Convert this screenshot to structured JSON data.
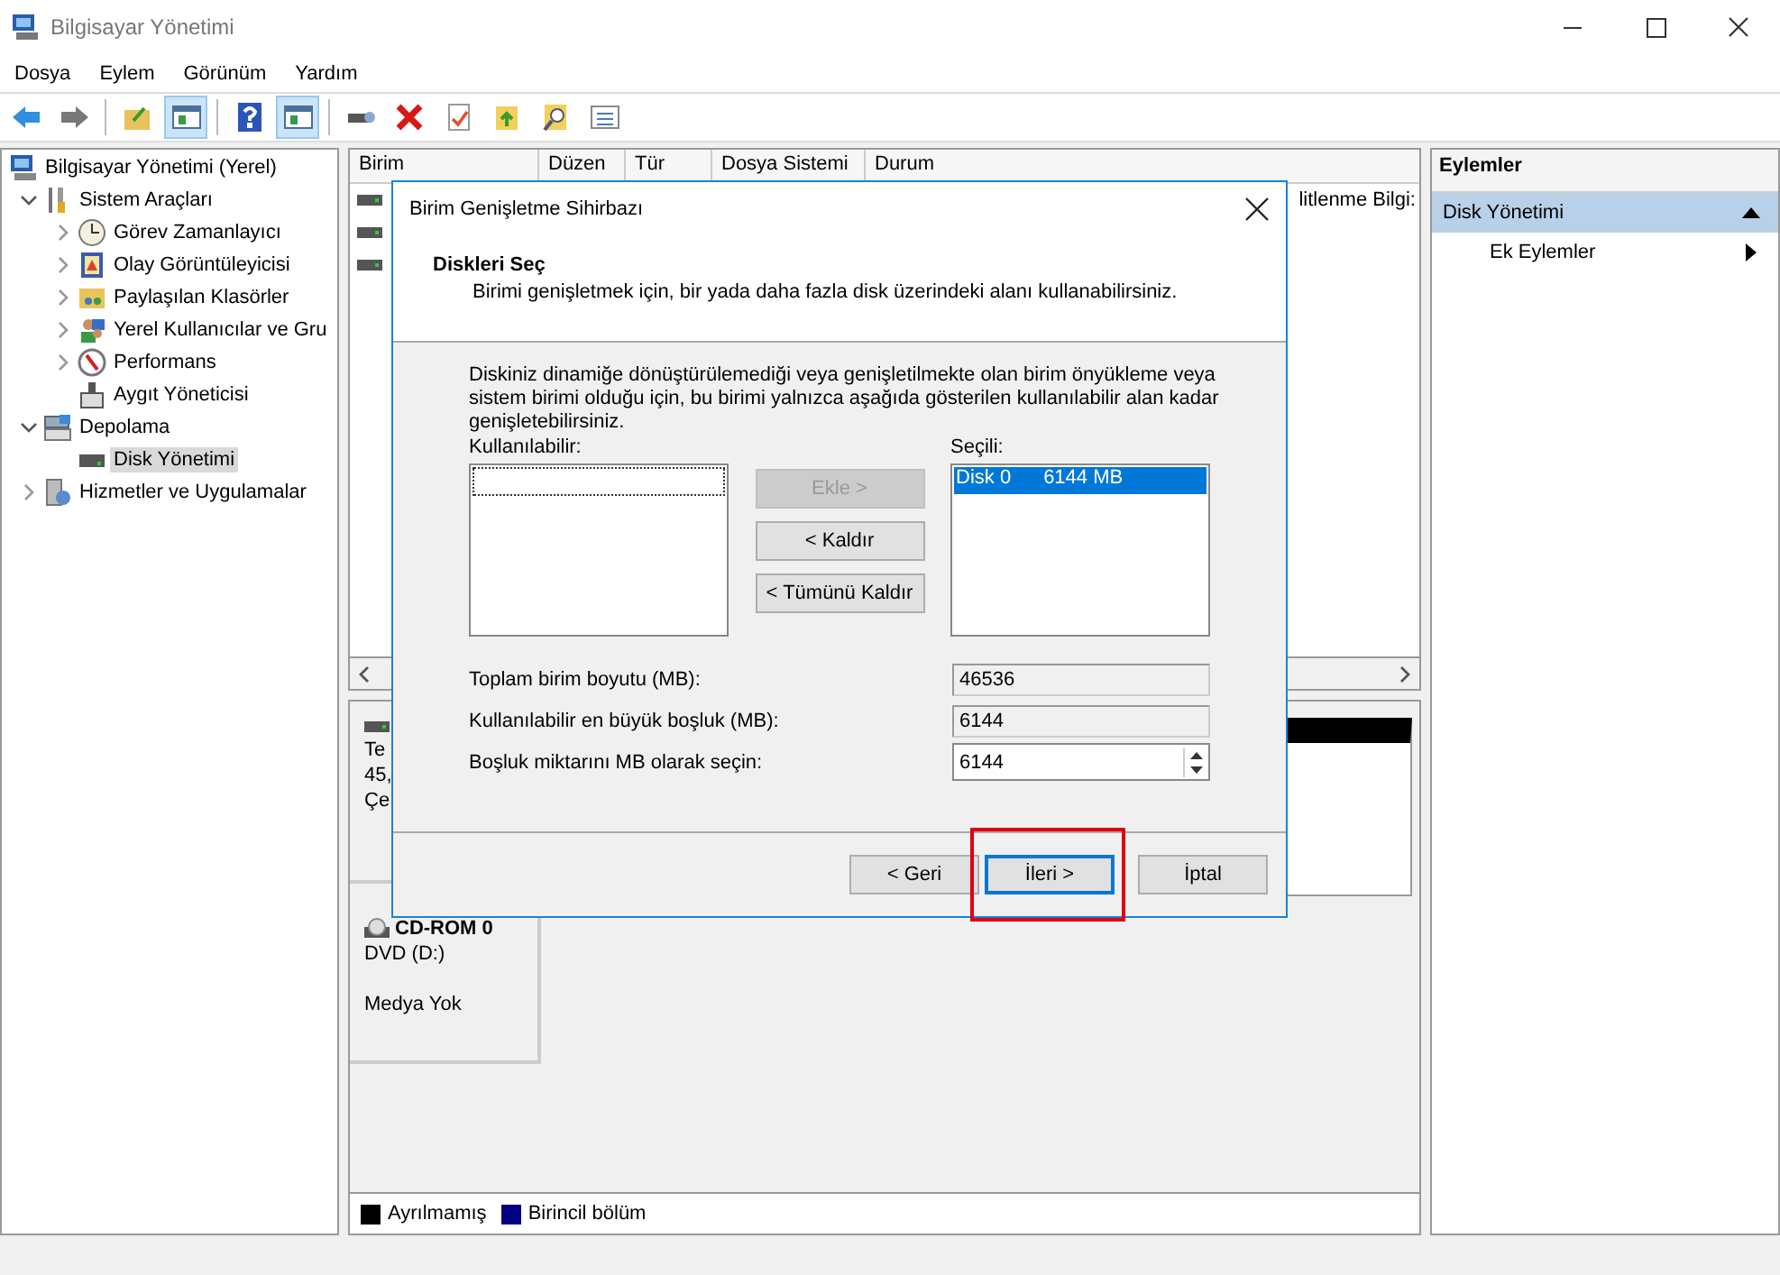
{
  "window": {
    "title": "Bilgisayar Yönetimi"
  },
  "menu": [
    "Dosya",
    "Eylem",
    "Görünüm",
    "Yardım"
  ],
  "toolbar": [
    {
      "kind": "back",
      "selected": false
    },
    {
      "kind": "forward",
      "selected": false
    },
    {
      "kind": "separator"
    },
    {
      "kind": "up",
      "selected": false
    },
    {
      "kind": "pane",
      "selected": true
    },
    {
      "kind": "separator"
    },
    {
      "kind": "help",
      "selected": false
    },
    {
      "kind": "pane",
      "selected": true
    },
    {
      "kind": "separator"
    },
    {
      "kind": "connect",
      "selected": false
    },
    {
      "kind": "delete",
      "selected": false
    },
    {
      "kind": "check",
      "selected": false
    },
    {
      "kind": "folder",
      "selected": false
    },
    {
      "kind": "find",
      "selected": false
    },
    {
      "kind": "list",
      "selected": false
    }
  ],
  "tree": [
    {
      "label": "Bilgisayar Yönetimi (Yerel)",
      "kind": "computer",
      "selected": false,
      "children": [
        {
          "label": "Sistem Araçları",
          "kind": "tools",
          "expanded": true,
          "selected": false,
          "children": [
            {
              "label": "Görev Zamanlayıcı",
              "kind": "clock",
              "expanded": false,
              "selected": false
            },
            {
              "label": "Olay Görüntüleyicisi",
              "kind": "log",
              "expanded": false,
              "selected": false
            },
            {
              "label": "Paylaşılan Klasörler",
              "kind": "folder",
              "expanded": false,
              "selected": false
            },
            {
              "label": "Yerel Kullanıcılar ve Gru",
              "kind": "users",
              "expanded": false,
              "selected": false
            },
            {
              "label": "Performans",
              "kind": "gauge",
              "expanded": false,
              "selected": false
            },
            {
              "label": "Aygıt Yöneticisi",
              "kind": "device",
              "selected": false
            }
          ]
        },
        {
          "label": "Depolama",
          "kind": "storage",
          "expanded": true,
          "selected": false,
          "children": [
            {
              "label": "Disk Yönetimi",
              "kind": "disk",
              "selected": true
            }
          ]
        },
        {
          "label": "Hizmetler ve Uygulamalar",
          "kind": "services",
          "expanded": false,
          "selected": false
        }
      ]
    }
  ],
  "volume_list": {
    "columns": [
      "Birim",
      "Düzen",
      "Tür",
      "Dosya Sistemi",
      "Durum"
    ],
    "rows": [
      {
        "kind": "volume",
        "trailing": "litlenme Bilgi:"
      },
      {
        "kind": "volume"
      },
      {
        "kind": "volume"
      }
    ]
  },
  "disks": [
    {
      "kind": "disk",
      "lines": [
        "Te",
        "45,",
        "Çe"
      ]
    },
    {
      "kind": "cdrom",
      "name": "CD-ROM 0",
      "lines": [
        "DVD (D:)"
      ],
      "status": "Medya Yok"
    }
  ],
  "legend": [
    {
      "label": "Ayrılmamış",
      "color": "#000000"
    },
    {
      "label": "Birincil bölüm",
      "color": "#000080"
    }
  ],
  "actions": {
    "title": "Eylemler",
    "sections": [
      {
        "label": "Disk Yönetimi",
        "expanded": true,
        "items": [
          "Ek Eylemler"
        ]
      }
    ]
  },
  "dialog": {
    "title": "Birim Genişletme Sihirbazı",
    "heading": "Diskleri Seç",
    "subheading": "Birimi genişletmek için, bir yada daha fazla disk üzerindeki alanı kullanabilirsiniz.",
    "intro": "Diskiniz dinamiğe dönüştürülemediği veya genişletilmekte olan birim önyükleme veya sistem birimi olduğu için, bu birimi yalnızca aşağıda gösterilen kullanılabilir alan kadar genişletebilirsiniz.",
    "available": {
      "label": "Kullanılabilir:"
    },
    "move_buttons": [
      {
        "label": "Ekle >",
        "disabled": true
      },
      {
        "label": "< Kaldır",
        "disabled": false
      },
      {
        "label": "< Tümünü Kaldır",
        "disabled": false
      }
    ],
    "chosen": {
      "label": "Seçili:",
      "items": [
        {
          "disk": "Disk 0",
          "size": "6144 MB",
          "selected": true
        }
      ]
    },
    "fields": [
      {
        "label": "Toplam birim boyutu (MB):",
        "value": "46536",
        "kind": "readonly"
      },
      {
        "label": "Kullanılabilir en büyük boşluk (MB):",
        "value": "6144",
        "kind": "readonly"
      },
      {
        "label": "Boşluk miktarını MB olarak seçin:",
        "value": "6144",
        "kind": "spinner"
      }
    ],
    "nav_buttons": [
      {
        "label": "< Geri",
        "default": false,
        "highlighted": false
      },
      {
        "label": "İleri >",
        "default": true,
        "highlighted": true
      },
      {
        "label": "İptal",
        "default": false,
        "highlighted": false
      }
    ]
  }
}
